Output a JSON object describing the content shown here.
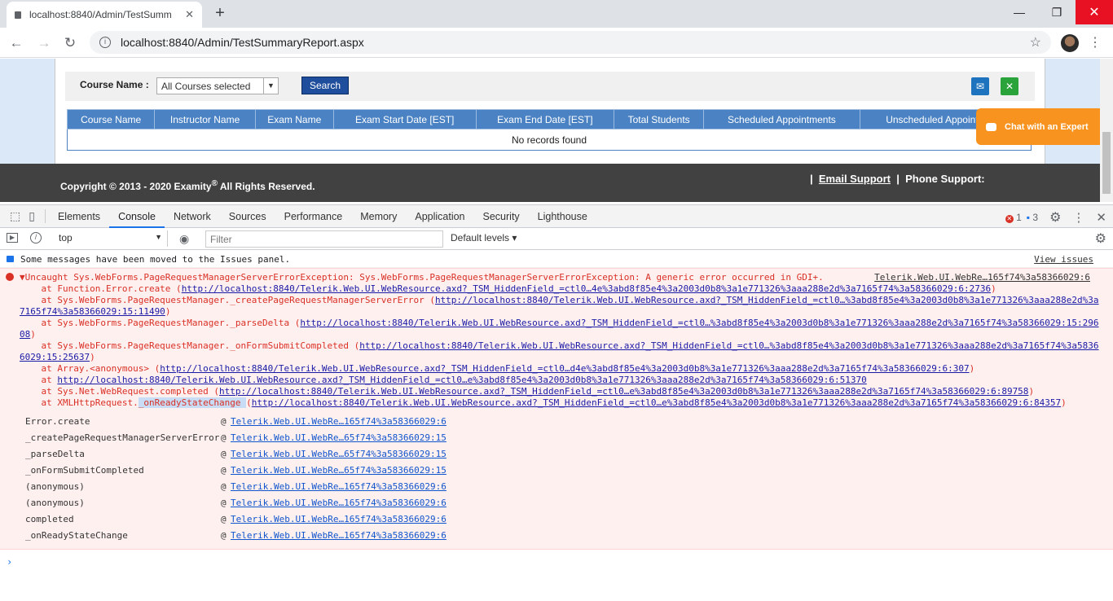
{
  "browser": {
    "tab_title": "localhost:8840/Admin/TestSumm",
    "url": "localhost:8840/Admin/TestSummaryReport.aspx"
  },
  "page": {
    "course_label": "Course Name :",
    "course_select": "All Courses selected",
    "search_button": "Search",
    "columns": [
      "Course Name",
      "Instructor Name",
      "Exam Name",
      "Exam Start Date [EST]",
      "Exam End Date [EST]",
      "Total Students",
      "Scheduled Appointments",
      "Unscheduled Appointments"
    ],
    "empty_text": "No records found",
    "copyright": "Copyright © 2013 - 2020 Examity",
    "copyright_mark": "®",
    "copyright_tail": "All Rights Reserved.",
    "sep": "|",
    "email_support": "Email Support",
    "phone_support": "Phone Support:",
    "chat_label": "Chat with an Expert"
  },
  "devtools": {
    "tabs": [
      "Elements",
      "Console",
      "Network",
      "Sources",
      "Performance",
      "Memory",
      "Application",
      "Security",
      "Lighthouse"
    ],
    "active_tab": "Console",
    "error_count": "1",
    "message_count": "3",
    "context": "top",
    "filter_placeholder": "Filter",
    "levels": "Default levels ▾",
    "moved_msg": "Some messages have been moved to the Issues panel.",
    "view_issues": "View issues",
    "error_head": "▼Uncaught Sys.WebForms.PageRequestManagerServerErrorException: Sys.WebForms.PageRequestManagerServerErrorException: A generic error occurred in GDI+.",
    "error_src": "Telerik.Web.UI.WebRe…165f74%3a58366029:6",
    "stack": [
      {
        "prefix": "    at Function.Error.create (",
        "link": "http://localhost:8840/Telerik.Web.UI.WebResource.axd?_TSM_HiddenField_=ctl0…4e%3abd8f85e4%3a2003d0b8%3a1e771326%3aaa288e2d%3a7165f74%3a58366029:6:2736",
        "suffix": ")"
      },
      {
        "prefix": "    at Sys.WebForms.PageRequestManager._createPageRequestManagerServerError (",
        "link": "http://localhost:8840/Telerik.Web.UI.WebResource.axd?_TSM_HiddenField_=ctl0…%3abd8f85e4%3a2003d0b8%3a1e771326%3aaa288e2d%3a\n7165f74%3a58366029:15:11490",
        "suffix": ")"
      },
      {
        "prefix": "    at Sys.WebForms.PageRequestManager._parseDelta (",
        "link": "http://localhost:8840/Telerik.Web.UI.WebResource.axd?_TSM_HiddenField_=ctl0…%3abd8f85e4%3a2003d0b8%3a1e771326%3aaa288e2d%3a7165f74%3a58366029:15:296\n08",
        "suffix": ")"
      },
      {
        "prefix": "    at Sys.WebForms.PageRequestManager._onFormSubmitCompleted (",
        "link": "http://localhost:8840/Telerik.Web.UI.WebResource.axd?_TSM_HiddenField_=ctl0…%3abd8f85e4%3a2003d0b8%3a1e771326%3aaa288e2d%3a7165f74%3a5836\n6029:15:25637",
        "suffix": ")"
      },
      {
        "prefix": "    at Array.<anonymous> (",
        "link": "http://localhost:8840/Telerik.Web.UI.WebResource.axd?_TSM_HiddenField_=ctl0…d4e%3abd8f85e4%3a2003d0b8%3a1e771326%3aaa288e2d%3a7165f74%3a58366029:6:307",
        "suffix": ")"
      },
      {
        "prefix": "    at ",
        "link": "http://localhost:8840/Telerik.Web.UI.WebResource.axd?_TSM_HiddenField_=ctl0…e%3abd8f85e4%3a2003d0b8%3a1e771326%3aaa288e2d%3a7165f74%3a58366029:6:51370",
        "suffix": ""
      },
      {
        "prefix": "    at Sys.Net.WebRequest.completed (",
        "link": "http://localhost:8840/Telerik.Web.UI.WebResource.axd?_TSM_HiddenField_=ctl0…e%3abd8f85e4%3a2003d0b8%3a1e771326%3aaa288e2d%3a7165f74%3a58366029:6:89758",
        "suffix": ")"
      },
      {
        "prefix": "    at XMLHttpRequest.",
        "hl": "_onReadyStateChange ",
        "mid": "(",
        "link": "http://localhost:8840/Telerik.Web.UI.WebResource.axd?_TSM_HiddenField_=ctl0…e%3abd8f85e4%3a2003d0b8%3a1e771326%3aaa288e2d%3a7165f74%3a58366029:6:84357",
        "suffix": ")"
      }
    ],
    "frames": [
      {
        "fn": "Error.create",
        "at": "@",
        "src": "Telerik.Web.UI.WebRe…165f74%3a58366029:6"
      },
      {
        "fn": "_createPageRequestManagerServerError",
        "at": "@",
        "src": "Telerik.Web.UI.WebRe…65f74%3a58366029:15"
      },
      {
        "fn": "_parseDelta",
        "at": "@",
        "src": "Telerik.Web.UI.WebRe…65f74%3a58366029:15"
      },
      {
        "fn": "_onFormSubmitCompleted",
        "at": "@",
        "src": "Telerik.Web.UI.WebRe…65f74%3a58366029:15"
      },
      {
        "fn": "(anonymous)",
        "at": "@",
        "src": "Telerik.Web.UI.WebRe…165f74%3a58366029:6"
      },
      {
        "fn": "(anonymous)",
        "at": "@",
        "src": "Telerik.Web.UI.WebRe…165f74%3a58366029:6"
      },
      {
        "fn": "completed",
        "at": "@",
        "src": "Telerik.Web.UI.WebRe…165f74%3a58366029:6"
      },
      {
        "fn": "_onReadyStateChange",
        "at": "@",
        "src": "Telerik.Web.UI.WebRe…165f74%3a58366029:6"
      }
    ],
    "prompt": "›"
  },
  "colors": {
    "grid_header": "#4a82c4",
    "search_button": "#1f4e9c",
    "footer": "#414141",
    "chat": "#f7931e",
    "error": "#d93025"
  }
}
